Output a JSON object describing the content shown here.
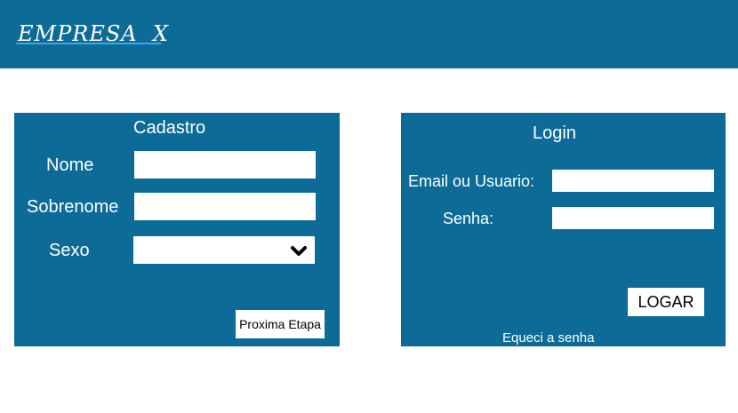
{
  "header": {
    "logo_text": "EMPRESA  X"
  },
  "cadastro": {
    "title": "Cadastro",
    "nome_label": "Nome",
    "nome_value": "",
    "sobrenome_label": "Sobrenome",
    "sobrenome_value": "",
    "sexo_label": "Sexo",
    "sexo_value": "",
    "next_button": "Proxima Etapa"
  },
  "login": {
    "title": "Login",
    "email_label": "Email ou Usuario:",
    "email_value": "",
    "senha_label": "Senha:",
    "senha_value": "",
    "submit_button": "LOGAR",
    "forgot_link": "Equeci a senha"
  },
  "icons": {
    "sexo_dropdown": "chevron-down-icon"
  },
  "colors": {
    "brand_blue": "#0d6c97",
    "logo_underline": "#3aa6ee",
    "field_background": "#ffffff",
    "text_on_blue": "#ffffff"
  }
}
